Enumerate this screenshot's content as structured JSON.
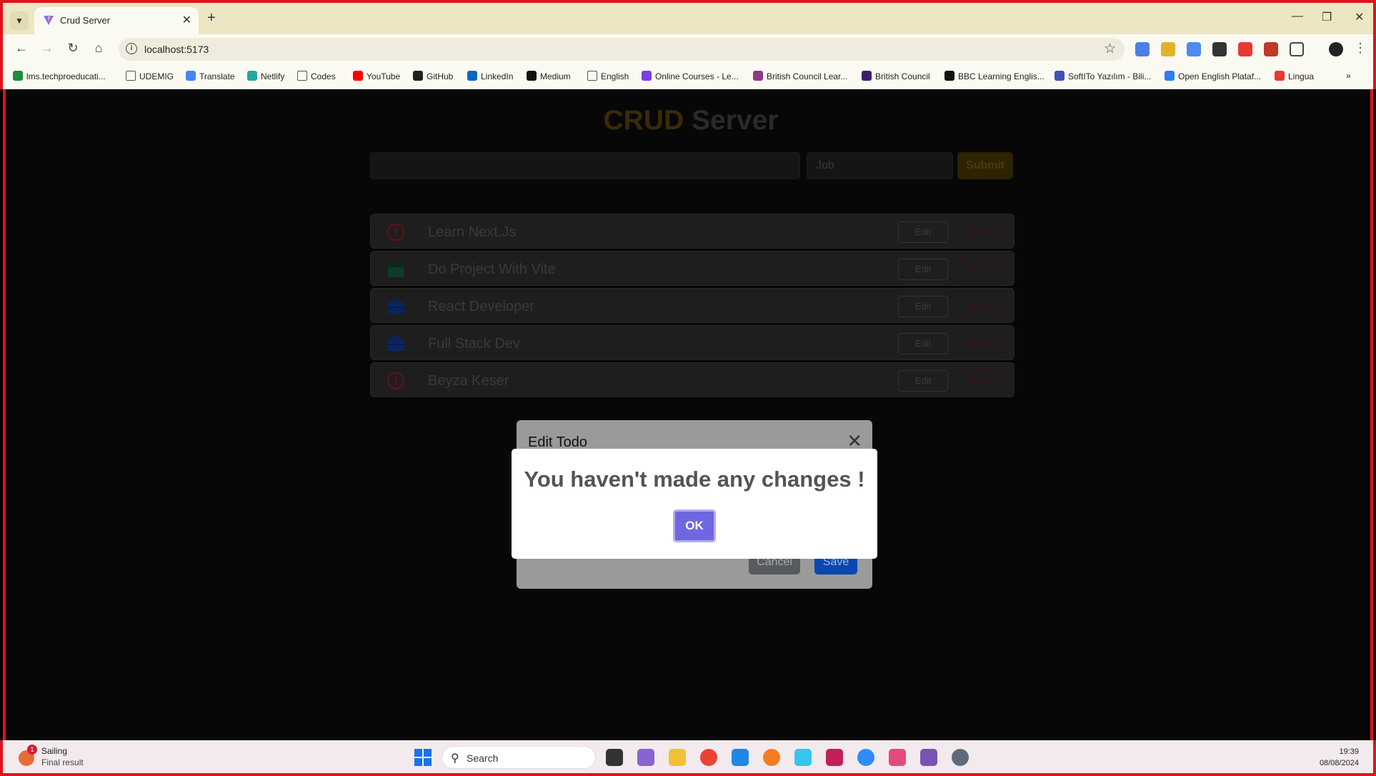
{
  "browser": {
    "tab_title": "Crud Server",
    "url": "localhost:5173",
    "bookmarks": [
      {
        "label": "lms.techproeducati...",
        "color": "#1e8e3e"
      },
      {
        "label": "UDEMIG",
        "color": "folder"
      },
      {
        "label": "Translate",
        "color": "#4285f4"
      },
      {
        "label": "Netlify",
        "color": "#20a9a0"
      },
      {
        "label": "Codes",
        "color": "folder"
      },
      {
        "label": "YouTube",
        "color": "#ff0000"
      },
      {
        "label": "GitHub",
        "color": "#222222"
      },
      {
        "label": "LinkedIn",
        "color": "#0a66c2"
      },
      {
        "label": "Medium",
        "color": "#111111"
      },
      {
        "label": "English",
        "color": "folder"
      },
      {
        "label": "Online Courses - Le...",
        "color": "#7b3fe4"
      },
      {
        "label": "British Council Lear...",
        "color": "#8e3a86"
      },
      {
        "label": "British Council",
        "color": "#3b1f6e"
      },
      {
        "label": "BBC Learning Englis...",
        "color": "#111111"
      },
      {
        "label": "SoftITo Yazılım - Bili...",
        "color": "#3f51b5"
      },
      {
        "label": "Open English Plataf...",
        "color": "#2e7ef2"
      },
      {
        "label": "Lingua",
        "color": "#e53935"
      }
    ]
  },
  "app": {
    "title_part1": "CRUD",
    "title_part2": "Server",
    "todo_input_value": "",
    "job_placeholder": "Job",
    "submit_label": "Submit",
    "todos": [
      {
        "label": "Learn Next.Js",
        "icon": "alert-circle-icon",
        "edit": "Edit",
        "delete": "Delete"
      },
      {
        "label": "Do Project With Vite",
        "icon": "calendar-icon",
        "edit": "Edit",
        "delete": "Delete"
      },
      {
        "label": "React Developer",
        "icon": "briefcase-icon",
        "edit": "Edit",
        "delete": "Delete"
      },
      {
        "label": "Full Stack Dev",
        "icon": "briefcase-icon",
        "edit": "Edit",
        "delete": "Delete"
      },
      {
        "label": "Beyza Keser",
        "icon": "alert-circle-icon",
        "edit": "Edit",
        "delete": "Delete"
      }
    ]
  },
  "edit_modal": {
    "title": "Edit Todo",
    "cancel_label": "Cancel",
    "save_label": "Save"
  },
  "alert": {
    "message": "You haven't made any changes !",
    "ok_label": "OK"
  },
  "taskbar": {
    "weather_title": "Sailing",
    "weather_subtitle": "Final result",
    "weather_badge": "1",
    "search_label": "Search",
    "time": "19:39",
    "date": "08/08/2024"
  },
  "colors": {
    "accent_ok": "#7066e0",
    "save_blue": "#0b47b2",
    "frame_red": "#e0121b"
  }
}
